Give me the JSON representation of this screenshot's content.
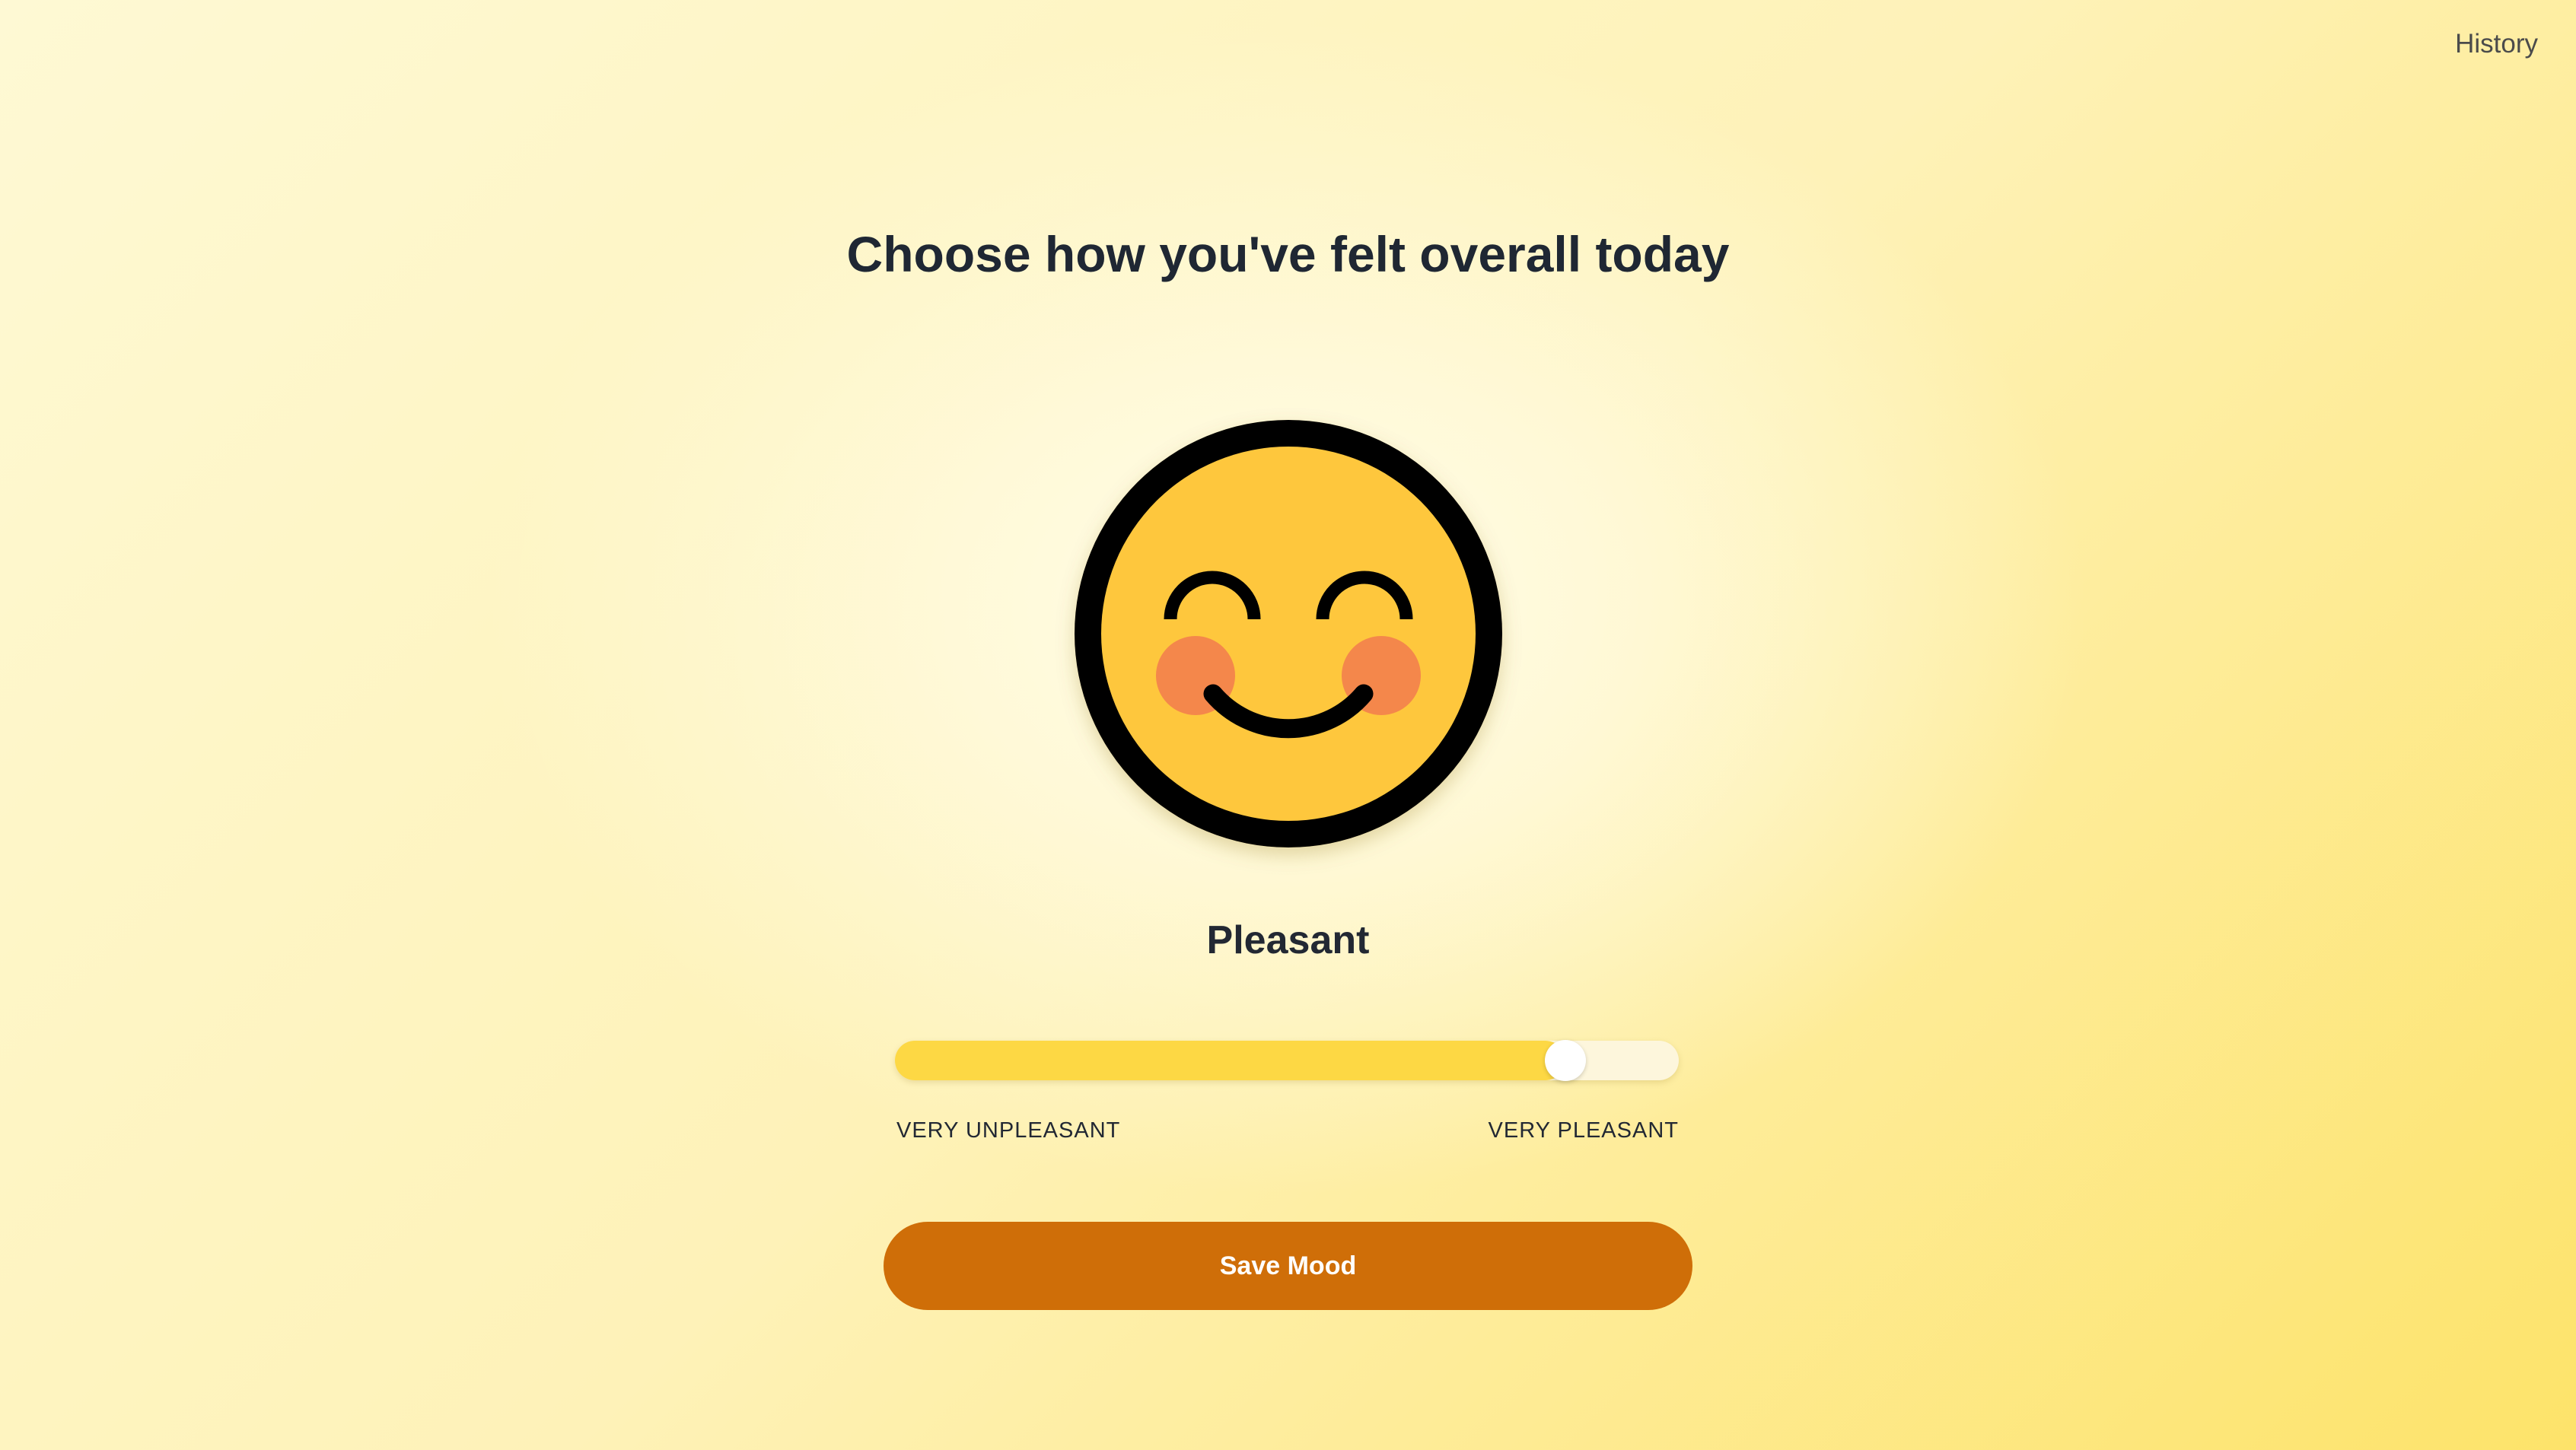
{
  "nav": {
    "history_label": "History"
  },
  "title": "Choose how you've felt overall today",
  "mood": {
    "label": "Pleasant",
    "icon": "smiling-face-icon",
    "value_fraction": 0.855
  },
  "slider": {
    "min_label": "VERY UNPLEASANT",
    "max_label": "VERY PLEASANT"
  },
  "save_label": "Save Mood",
  "colors": {
    "face": "#fec73d",
    "cheeks": "#f4874b",
    "outline": "#000000",
    "slider_fill": "#fdd844",
    "save_button": "#cf6e08",
    "text": "#1f2733"
  }
}
